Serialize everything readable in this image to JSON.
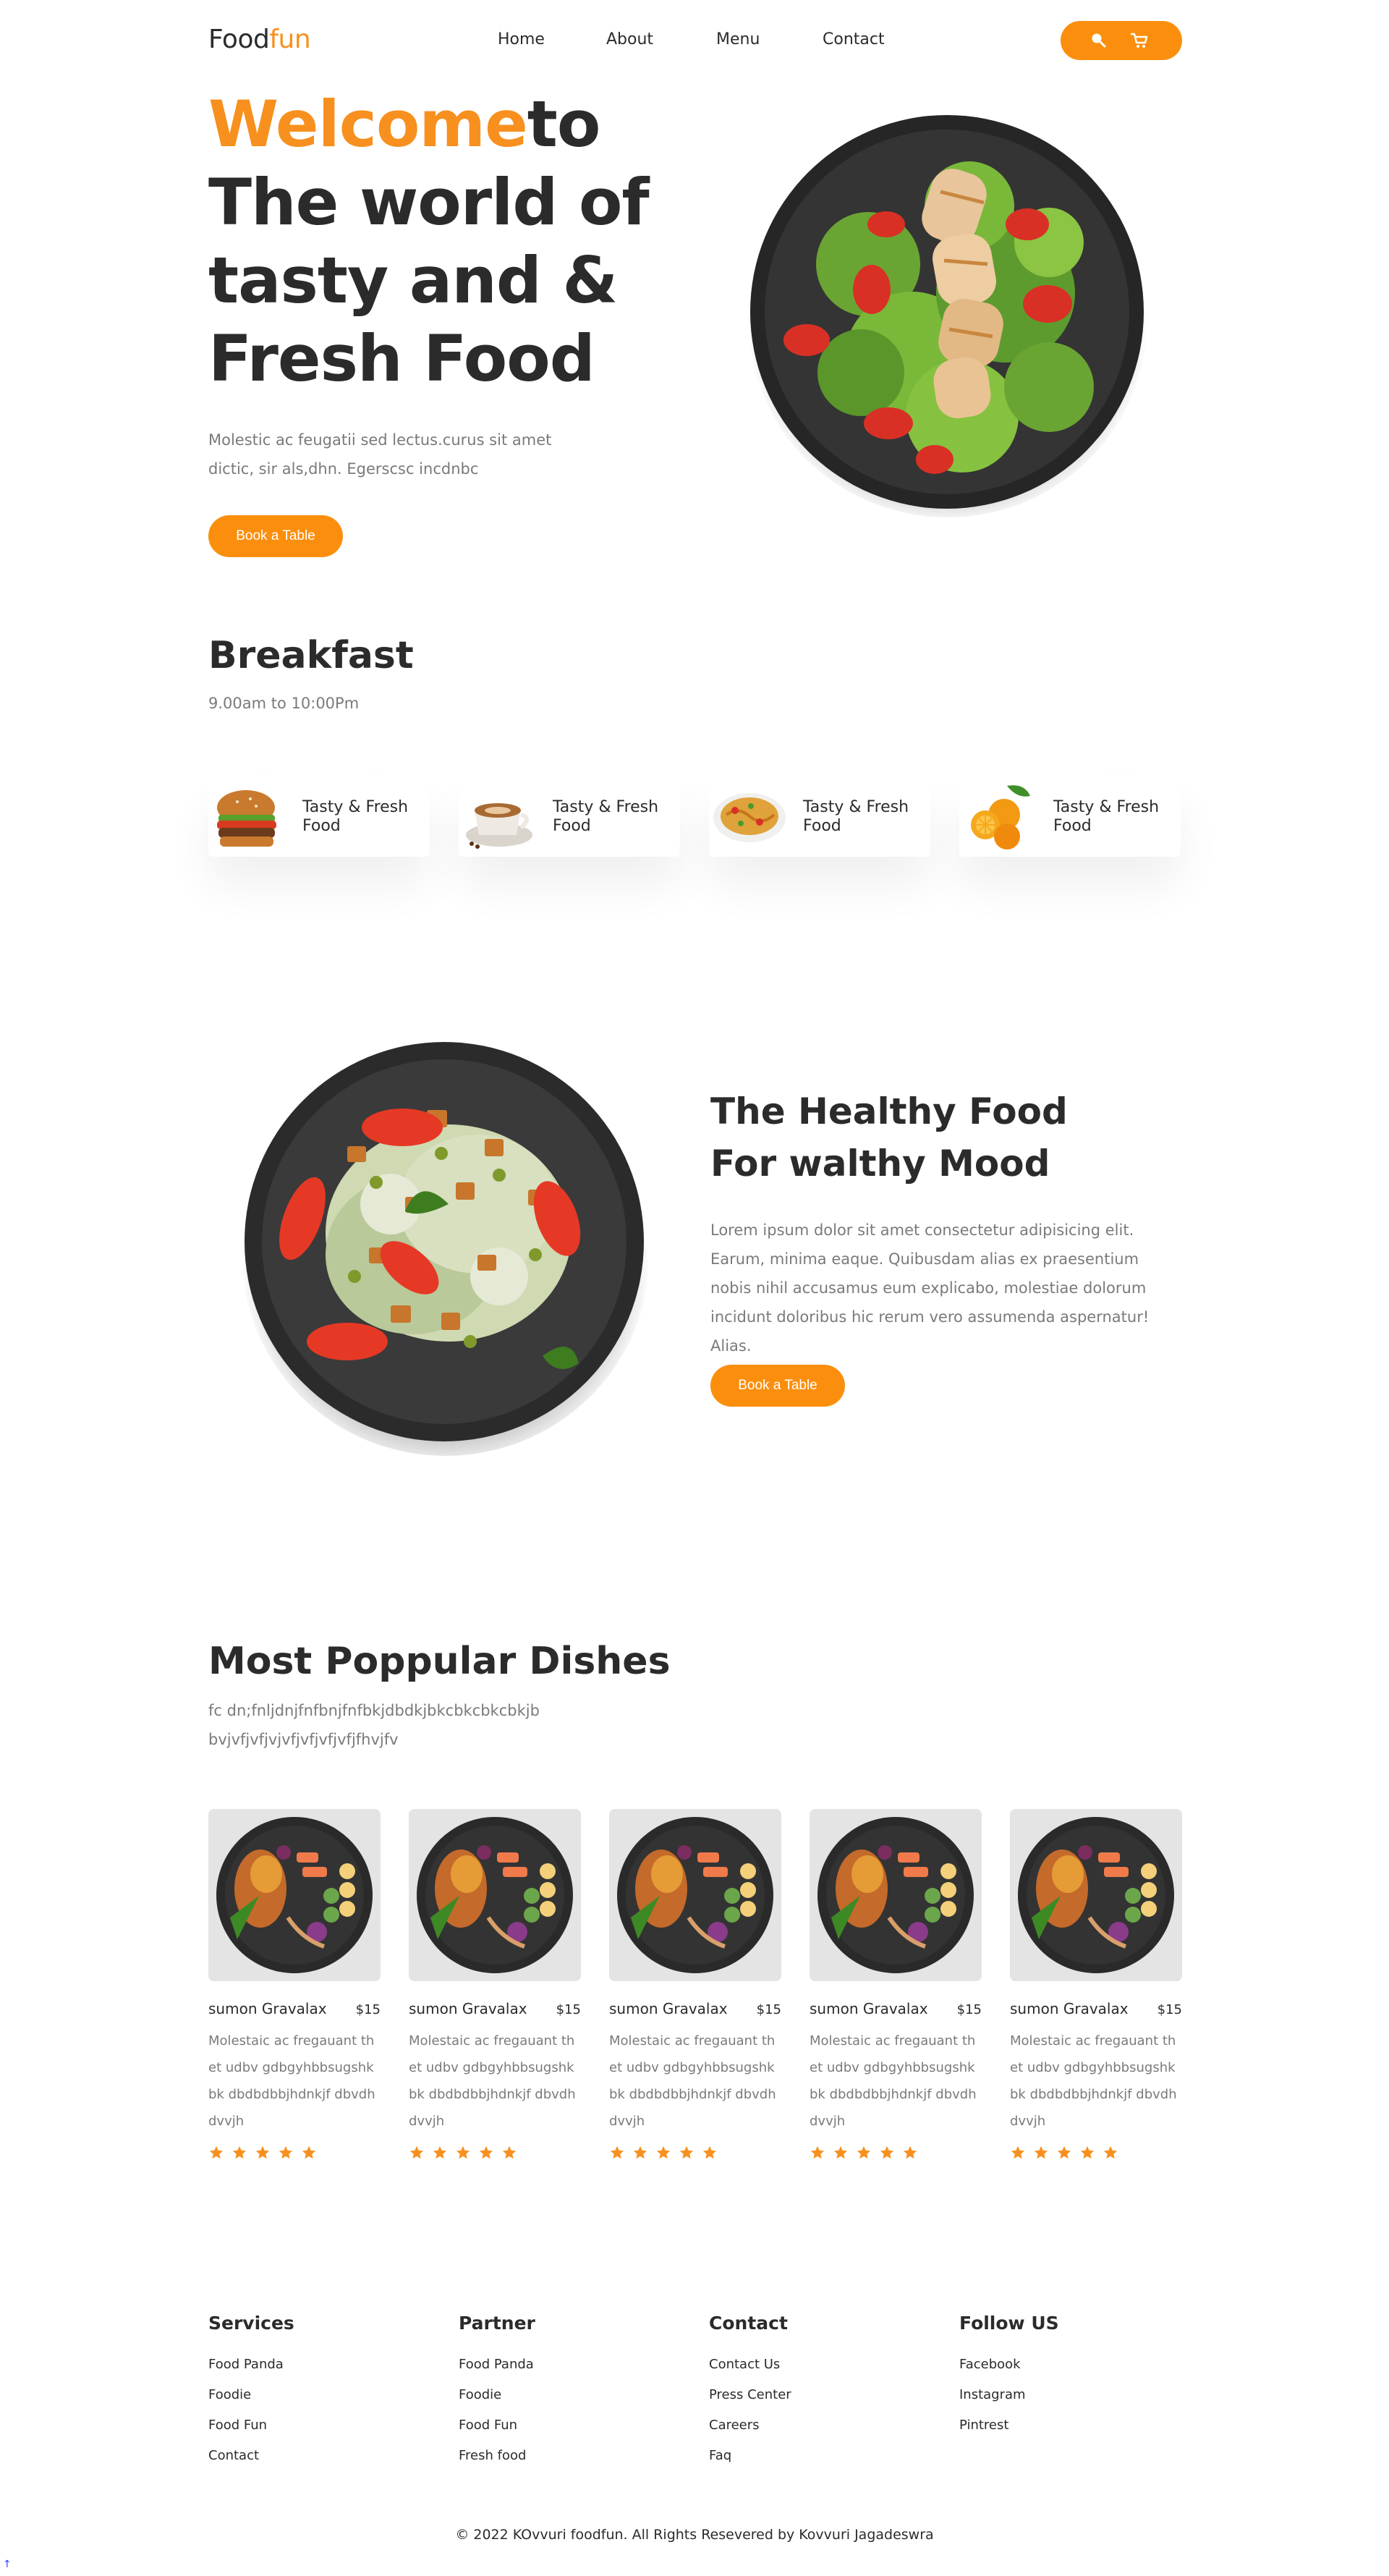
{
  "nav": {
    "logo_main": "Food",
    "logo_accent": "fun",
    "links": [
      "Home",
      "About",
      "Menu",
      "Contact"
    ],
    "search_icon": "search-icon",
    "cart_icon": "cart-icon"
  },
  "hero": {
    "title_accent": "Welcome",
    "title_rest": "to The world of tasty and & Fresh Food",
    "description": "Molestic ac feugatii sed lectus.curus sit amet dictic, sir als,dhn. Egerscsc incdnbc",
    "button": "Book a Table"
  },
  "breakfast": {
    "title": "Breakfast",
    "hours": "9.00am to 10:00Pm",
    "cards": [
      {
        "label": "Tasty & Fresh Food",
        "icon": "burger-icon"
      },
      {
        "label": "Tasty & Fresh Food",
        "icon": "coffee-icon"
      },
      {
        "label": "Tasty & Fresh Food",
        "icon": "noodles-icon"
      },
      {
        "label": "Tasty & Fresh Food",
        "icon": "orange-icon"
      }
    ]
  },
  "healthy": {
    "title_line1": "The Healthy Food",
    "title_line2": "For walthy Mood",
    "description": "Lorem ipsum dolor sit amet consectetur adipisicing elit. Earum, minima eaque. Quibusdam alias ex praesentium nobis nihil accusamus eum explicabo, molestiae dolorum incidunt doloribus hic rerum vero assumenda aspernatur! Alias.",
    "button": "Book a Table"
  },
  "popular": {
    "title": "Most Poppular Dishes",
    "subtitle": "fc dn;fnljdnjfnfbnjfnfbkjdbdkjbkcbkcbkcbkjb bvjvfjvfjvjvfjvfjvfjvfjfhvjfv",
    "dishes": [
      {
        "name": "sumon Gravalax",
        "price": "$15",
        "description": "Molestaic ac fregauant thet udbv gdbgyhbbsugshkbk dbdbdbbjhdnkjf dbvdhdvvjh",
        "rating": 5
      },
      {
        "name": "sumon Gravalax",
        "price": "$15",
        "description": "Molestaic ac fregauant thet udbv gdbgyhbbsugshkbk dbdbdbbjhdnkjf dbvdhdvvjh",
        "rating": 5
      },
      {
        "name": "sumon Gravalax",
        "price": "$15",
        "description": "Molestaic ac fregauant thet udbv gdbgyhbbsugshkbk dbdbdbbjhdnkjf dbvdhdvvjh",
        "rating": 5
      },
      {
        "name": "sumon Gravalax",
        "price": "$15",
        "description": "Molestaic ac fregauant thet udbv gdbgyhbbsugshkbk dbdbdbbjhdnkjf dbvdhdvvjh",
        "rating": 5
      },
      {
        "name": "sumon Gravalax",
        "price": "$15",
        "description": "Molestaic ac fregauant thet udbv gdbgyhbbsugshkbk dbdbdbbjhdnkjf dbvdhdvvjh",
        "rating": 5
      }
    ]
  },
  "footer": {
    "columns": [
      {
        "heading": "Services",
        "links": [
          "Food Panda",
          "Foodie",
          "Food Fun",
          "Contact"
        ]
      },
      {
        "heading": "Partner",
        "links": [
          "Food Panda",
          "Foodie",
          "Food Fun",
          "Fresh food"
        ]
      },
      {
        "heading": "Contact",
        "links": [
          "Contact Us",
          "Press Center",
          "Careers",
          "Faq"
        ]
      },
      {
        "heading": "Follow US",
        "links": [
          "Facebook",
          "Instagram",
          "Pintrest"
        ]
      }
    ],
    "copyright": "© 2022 KOvvuri foodfun. All Rights Resevered by Kovvuri Jagadeswra"
  },
  "colors": {
    "accent": "#f7901e",
    "button": "#fb8f0d",
    "text": "#2b2b2b",
    "muted": "#7a7a7a"
  }
}
